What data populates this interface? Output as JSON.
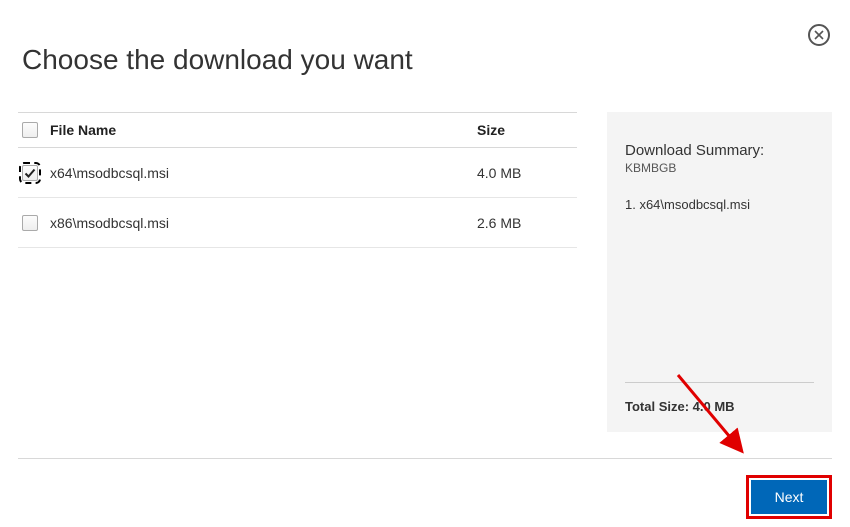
{
  "title": "Choose the download you want",
  "columns": {
    "file_name": "File Name",
    "size": "Size"
  },
  "files": [
    {
      "name": "x64\\msodbcsql.msi",
      "size": "4.0 MB",
      "checked": true
    },
    {
      "name": "x86\\msodbcsql.msi",
      "size": "2.6 MB",
      "checked": false
    }
  ],
  "summary": {
    "title": "Download Summary:",
    "units": "KBMBGB",
    "items": [
      "1. x64\\msodbcsql.msi"
    ],
    "total_label": "Total Size: 4.0 MB"
  },
  "next_label": "Next"
}
